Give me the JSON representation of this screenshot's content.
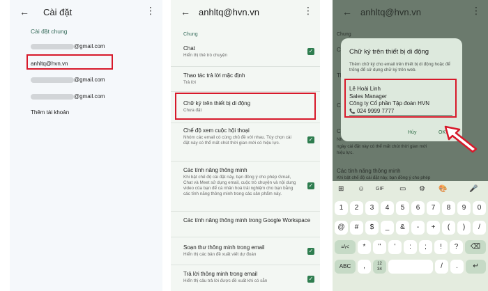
{
  "panel1": {
    "title": "Cài đặt",
    "back_glyph": "←",
    "menu_glyph": "⋮",
    "section": "Cài đặt chung",
    "accounts": [
      "@gmail.com",
      "anhltq@hvn.vn",
      "@gmail.com",
      "@gmail.com"
    ],
    "add_account": "Thêm tài khoản"
  },
  "panel2": {
    "title": "anhltq@hvn.vn",
    "back_glyph": "←",
    "menu_glyph": "⋮",
    "section": "Chung",
    "items": [
      {
        "title": "Chat",
        "sub": "Hiển thị thẻ trò chuyện",
        "checked": true
      },
      {
        "title": "Thao tác trả lời mặc định",
        "sub": "Trả lời",
        "checked": false
      },
      {
        "title": "Chữ ký trên thiết bị di động",
        "sub": "Chưa đặt",
        "checked": false
      },
      {
        "title": "Chế độ xem cuộc hội thoại",
        "sub": "Nhóm các email có cùng chủ đề với nhau. Tùy chọn cài đặt này có thể mất chút thời gian mới có hiệu lực.",
        "checked": true
      },
      {
        "title": "Các tính năng thông minh",
        "sub": "Khi bật chế độ cài đặt này, bạn đồng ý cho phép Gmail, Chat và Meet sử dụng email, cuộc trò chuyện và nội dung video của bạn để cá nhân hoá trải nghiệm cho bạn bằng các tính năng thông minh trong các sản phẩm này.",
        "checked": true
      },
      {
        "title": "Các tính năng thông minh trong Google Workspace",
        "sub": "",
        "checked": false
      },
      {
        "title": "Soạn thư thông minh trong email",
        "sub": "Hiển thị các bản đề xuất viết dự đoán",
        "checked": true
      },
      {
        "title": "Trả lời thông minh trong email",
        "sub": "Hiển thị câu trả lời được đề xuất khi có sẵn",
        "checked": true
      }
    ]
  },
  "panel3": {
    "title": "anhltq@hvn.vn",
    "back_glyph": "←",
    "menu_glyph": "⋮",
    "section": "Chung",
    "bg_fragments": [
      "Ch",
      "Th",
      "Ch",
      "Ch",
      "Nh",
      "ngày cài đặt này có thể mất chút thời gian mới",
      "hiệu lực.",
      "Các tính năng thông minh",
      "Khi bật chế độ cài đặt này, bạn đồng ý cho phép"
    ],
    "dialog": {
      "title": "Chữ ký trên thiết bị di động",
      "description": "Thêm chữ ký cho email trên thiết bị di động hoặc để trống để sử dụng chữ ký trên web.",
      "signature": [
        "Lê Hoài Linh",
        "Sales Manager",
        "Công ty Cổ phần Tập đoàn HVN",
        "024 9999 7777"
      ],
      "phone_icon": "📞",
      "cancel": "Hủy",
      "ok": "OK"
    },
    "keyboard": {
      "toolbar": [
        "⊞",
        "☺",
        "GIF",
        "⚙",
        "🎨",
        "🎤"
      ],
      "row1": [
        "1",
        "2",
        "3",
        "4",
        "5",
        "6",
        "7",
        "8",
        "9",
        "0"
      ],
      "row2": [
        "@",
        "#",
        "$",
        "_",
        "&",
        "-",
        "+",
        "(",
        ")",
        "/"
      ],
      "row3": [
        "=\\<",
        "*",
        "\"",
        "'",
        ":",
        ";",
        "!",
        "?",
        "⌫"
      ],
      "row4": [
        "ABC",
        ",",
        "12\n34",
        "",
        "/",
        ".",
        "↵"
      ]
    }
  },
  "colors": {
    "highlight": "#d7192a",
    "checkbox": "#2e7d4f",
    "accent": "#356b5a"
  }
}
